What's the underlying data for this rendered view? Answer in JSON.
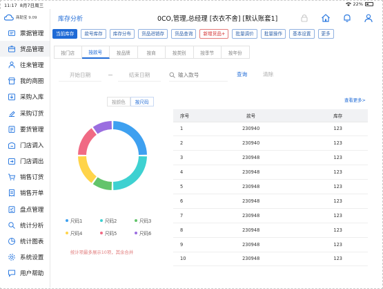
{
  "status_bar": {
    "time": "11:17",
    "date": "8月7日周三",
    "battery": "22%"
  },
  "logo": {
    "name": "商助宝 9.09"
  },
  "sidebar": {
    "items": [
      {
        "label": "票据管理",
        "icon": "ticket-icon",
        "active": false
      },
      {
        "label": "货品管理",
        "icon": "box-icon",
        "active": true
      },
      {
        "label": "往来管理",
        "icon": "users-icon",
        "active": false
      },
      {
        "label": "我的商圈",
        "icon": "shop-icon",
        "active": false
      },
      {
        "label": "采购入库",
        "icon": "inbound-icon",
        "active": false
      },
      {
        "label": "采购订货",
        "icon": "order-icon",
        "active": false
      },
      {
        "label": "要货管理",
        "icon": "request-icon",
        "active": false
      },
      {
        "label": "门店调入",
        "icon": "store-in-icon",
        "active": false
      },
      {
        "label": "门店调出",
        "icon": "store-out-icon",
        "active": false
      },
      {
        "label": "销售订货",
        "icon": "cart-icon",
        "active": false
      },
      {
        "label": "销售开单",
        "icon": "bill-icon",
        "active": false
      },
      {
        "label": "盘点管理",
        "icon": "inventory-icon",
        "active": false
      },
      {
        "label": "统计分析",
        "icon": "analytics-icon",
        "active": false
      },
      {
        "label": "统计图表",
        "icon": "pie-chart-icon",
        "active": false
      },
      {
        "label": "系统设置",
        "icon": "gear-icon",
        "active": false
      },
      {
        "label": "用户帮助",
        "icon": "help-icon",
        "active": false
      }
    ]
  },
  "header": {
    "module": "库存分析",
    "title": "0CO,管理,总经理 [衣衣不舍] [默认账套1]"
  },
  "toolbar": [
    {
      "label": "当前库存",
      "active": true,
      "style": "active"
    },
    {
      "label": "款号库存",
      "style": "normal"
    },
    {
      "label": "库存分布",
      "style": "normal"
    },
    {
      "label": "货品进销存",
      "style": "normal"
    },
    {
      "label": "货品查询",
      "style": "normal"
    },
    {
      "label": "新增货品+",
      "style": "red"
    },
    {
      "label": "批量调价",
      "style": "normal"
    },
    {
      "label": "批量操作",
      "style": "normal"
    },
    {
      "label": "基本设置",
      "style": "normal"
    },
    {
      "label": "更多",
      "style": "normal"
    }
  ],
  "subtabs": [
    {
      "label": "按门店",
      "active": false
    },
    {
      "label": "按款号",
      "active": true
    },
    {
      "label": "按品牌",
      "active": false
    },
    {
      "label": "按商",
      "active": false
    },
    {
      "label": "按类别",
      "active": false
    },
    {
      "label": "按季节",
      "active": false
    },
    {
      "label": "按年份",
      "active": false
    }
  ],
  "filter": {
    "start_date": "开始日期",
    "end_date": "结束日期",
    "search_placeholder": "输入款号",
    "query_label": "查询",
    "clear_label": "清除"
  },
  "chart_toggle": {
    "by_color": "按颜色",
    "by_size": "按尺码"
  },
  "chart_data": {
    "type": "pie",
    "style": "donut",
    "categories": [
      "尺码1",
      "尺码2",
      "尺码3",
      "尺码4",
      "尺码5",
      "尺码6"
    ],
    "values": [
      25,
      25,
      10,
      15,
      15,
      10
    ],
    "colors": [
      "#3ea0f0",
      "#3ed1d1",
      "#63c46b",
      "#ffd44a",
      "#f06a84",
      "#9b6ee0"
    ],
    "legend_position": "bottom"
  },
  "chart_hint": "统计项最多展示10项，其余合并",
  "table": {
    "more_label": "查看更多>",
    "columns": [
      "序号",
      "款号",
      "库存"
    ],
    "rows": [
      [
        "1",
        "230940",
        "123"
      ],
      [
        "2",
        "230940",
        "123"
      ],
      [
        "3",
        "230948",
        "123"
      ],
      [
        "4",
        "230948",
        "123"
      ],
      [
        "5",
        "230948",
        "123"
      ],
      [
        "6",
        "230948",
        "123"
      ],
      [
        "7",
        "230948",
        "123"
      ],
      [
        "8",
        "230948",
        "123"
      ],
      [
        "9",
        "230948",
        "123"
      ],
      [
        "10",
        "230948",
        "123"
      ]
    ]
  }
}
